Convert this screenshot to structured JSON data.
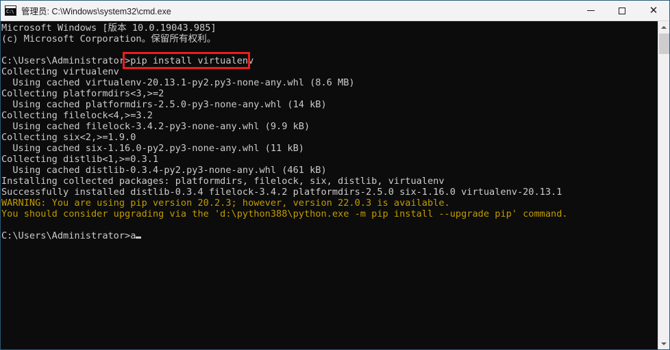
{
  "window": {
    "title": "管理员: C:\\Windows\\system32\\cmd.exe",
    "icon": "cmd-console-icon",
    "icon_text": "C:\\",
    "background": "#0c0c0c",
    "titlebar_background": "#f3f3f3",
    "border_color": "#2a5a78"
  },
  "controls": {
    "minimize_label": "—",
    "maximize_label": "☐",
    "close_label": "✕"
  },
  "highlight": {
    "color": "#ee1c1c",
    "target_text": "pip install virtualenv"
  },
  "scrollbar": {
    "up_label": "▲",
    "down_label": "▼",
    "thumb_position": "top"
  },
  "terminal": {
    "prompt": "C:\\Users\\Administrator>",
    "cursor_char": "_",
    "default_color": "#cccccc",
    "warning_color": "#c19c00",
    "lines": [
      {
        "text": "Microsoft Windows [版本 10.0.19043.985]",
        "color": "gray"
      },
      {
        "text": "(c) Microsoft Corporation。保留所有权利。",
        "color": "gray"
      },
      {
        "text": "",
        "color": "gray"
      },
      {
        "text": "C:\\Users\\Administrator>pip install virtualenv",
        "color": "gray"
      },
      {
        "text": "Collecting virtualenv",
        "color": "gray"
      },
      {
        "text": "  Using cached virtualenv-20.13.1-py2.py3-none-any.whl (8.6 MB)",
        "color": "gray"
      },
      {
        "text": "Collecting platformdirs<3,>=2",
        "color": "gray"
      },
      {
        "text": "  Using cached platformdirs-2.5.0-py3-none-any.whl (14 kB)",
        "color": "gray"
      },
      {
        "text": "Collecting filelock<4,>=3.2",
        "color": "gray"
      },
      {
        "text": "  Using cached filelock-3.4.2-py3-none-any.whl (9.9 kB)",
        "color": "gray"
      },
      {
        "text": "Collecting six<2,>=1.9.0",
        "color": "gray"
      },
      {
        "text": "  Using cached six-1.16.0-py2.py3-none-any.whl (11 kB)",
        "color": "gray"
      },
      {
        "text": "Collecting distlib<1,>=0.3.1",
        "color": "gray"
      },
      {
        "text": "  Using cached distlib-0.3.4-py2.py3-none-any.whl (461 kB)",
        "color": "gray"
      },
      {
        "text": "Installing collected packages: platformdirs, filelock, six, distlib, virtualenv",
        "color": "gray"
      },
      {
        "text": "Successfully installed distlib-0.3.4 filelock-3.4.2 platformdirs-2.5.0 six-1.16.0 virtualenv-20.13.1",
        "color": "gray"
      },
      {
        "text": "WARNING: You are using pip version 20.2.3; however, version 22.0.3 is available.",
        "color": "yellow"
      },
      {
        "text": "You should consider upgrading via the 'd:\\python388\\python.exe -m pip install --upgrade pip' command.",
        "color": "yellow"
      },
      {
        "text": "",
        "color": "gray"
      }
    ],
    "active_line": "C:\\Users\\Administrator>a"
  }
}
